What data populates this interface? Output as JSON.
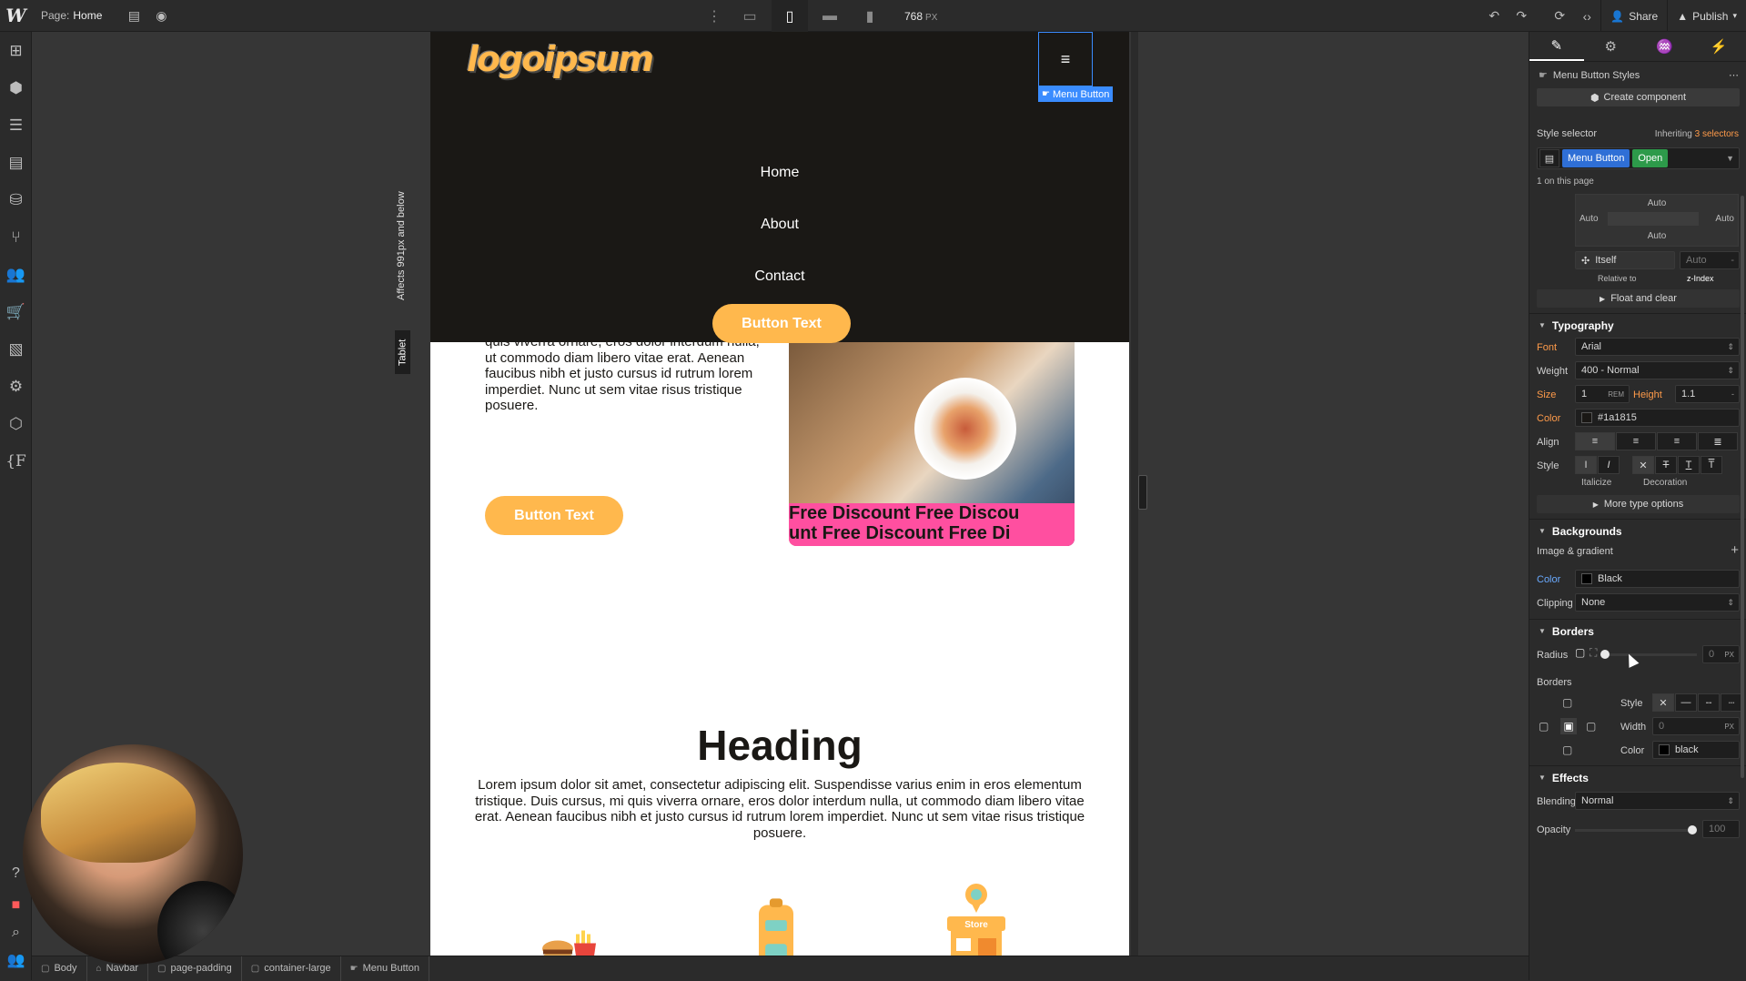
{
  "topbar": {
    "logo": "W",
    "page_label": "Page:",
    "page_name": "Home",
    "viewport_width": "768",
    "viewport_unit": "PX",
    "share_label": "Share",
    "publish_label": "Publish"
  },
  "site": {
    "logo_text": "logoipsum",
    "menu_tag": "Menu Button",
    "nav_links": [
      "Home",
      "About",
      "Contact"
    ],
    "nav_cta": "Button Text",
    "paragraph1": "quis viverra ornare, eros dolor interdum nulla, ut commodo diam libero vitae erat. Aenean faucibus nibh et justo cursus id rutrum lorem imperdiet. Nunc ut sem vitae risus tristique posuere.",
    "cta2": "Button Text",
    "strip_line1": "Free Discount   Free Discou",
    "strip_line2": "unt   Free Discount   Free Di",
    "heading": "Heading",
    "paragraph2": "Lorem ipsum dolor sit amet, consectetur adipiscing elit. Suspendisse varius enim in eros elementum tristique. Duis cursus, mi quis viverra ornare, eros dolor interdum nulla, ut commodo diam libero vitae erat. Aenean faucibus nibh et justo cursus id rutrum lorem imperdiet. Nunc ut sem vitae risus tristique posuere.",
    "store_sign": "Store"
  },
  "breakpoint": {
    "note": "Affects 991px and below",
    "tab": "Tablet"
  },
  "breadcrumbs": [
    "Body",
    "Navbar",
    "page-padding",
    "container-large",
    "Menu Button"
  ],
  "panel": {
    "title": "Menu Button Styles",
    "create_component": "Create component",
    "style_selector": "Style selector",
    "inheriting": "Inheriting",
    "selectors_count": "3 selectors",
    "selector_tags": [
      "Menu Button",
      "Open"
    ],
    "on_page": "1 on this page",
    "position": {
      "top": "Auto",
      "left": "Auto",
      "right": "Auto",
      "bottom": "Auto",
      "itself": "Itself",
      "auto": "Auto",
      "relative_to": "Relative to",
      "z_index": "z-Index"
    },
    "float_clear": "Float and clear",
    "typography": {
      "header": "Typography",
      "font_label": "Font",
      "font": "Arial",
      "weight_label": "Weight",
      "weight": "400 - Normal",
      "size_label": "Size",
      "size": "1",
      "size_unit": "REM",
      "height_label": "Height",
      "height": "1.1",
      "height_unit": "-",
      "color_label": "Color",
      "color": "#1a1815",
      "align_label": "Align",
      "style_label": "Style",
      "italicize": "Italicize",
      "decoration": "Decoration",
      "more": "More type options"
    },
    "backgrounds": {
      "header": "Backgrounds",
      "image_gradient": "Image & gradient",
      "color_label": "Color",
      "color": "Black",
      "clipping_label": "Clipping",
      "clipping": "None"
    },
    "borders": {
      "header": "Borders",
      "radius_label": "Radius",
      "radius": "0",
      "radius_unit": "PX",
      "borders_label": "Borders",
      "style_label": "Style",
      "width_label": "Width",
      "width": "0",
      "width_unit": "PX",
      "color_label": "Color",
      "color": "black"
    },
    "effects": {
      "header": "Effects",
      "blending_label": "Blending",
      "blending": "Normal",
      "opacity_label": "Opacity",
      "opacity": "100"
    }
  },
  "colors": {
    "accent": "#ffb84d",
    "navbar_bg": "#1a1815",
    "selection_blue": "#3a8cff",
    "strip_pink": "#ff4fa0"
  }
}
